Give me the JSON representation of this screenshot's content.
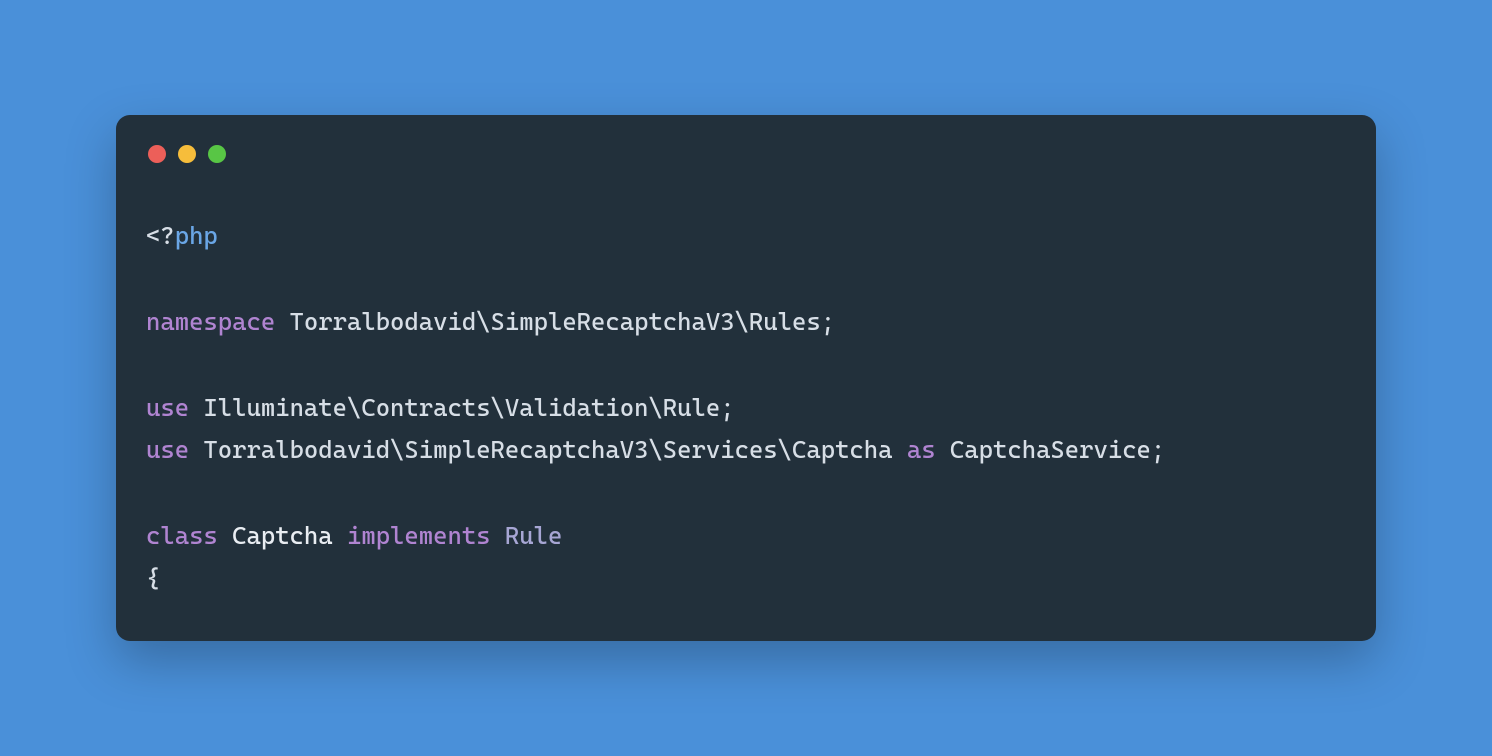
{
  "code": {
    "line1": {
      "open": "<?",
      "php": "php"
    },
    "line3": {
      "namespace": "namespace",
      "ns": " Torralbodavid\\SimpleRecaptchaV3\\Rules;"
    },
    "line5": {
      "use": "use",
      "path": " Illuminate\\Contracts\\Validation\\Rule;"
    },
    "line6": {
      "use": "use",
      "path": " Torralbodavid\\SimpleRecaptchaV3\\Services\\Captcha ",
      "as": "as",
      "alias": " CaptchaService;"
    },
    "line8": {
      "class": "class",
      "name": " Captcha ",
      "implements": "implements",
      "space": " ",
      "iface": "Rule"
    },
    "line9": {
      "brace": "{"
    }
  }
}
